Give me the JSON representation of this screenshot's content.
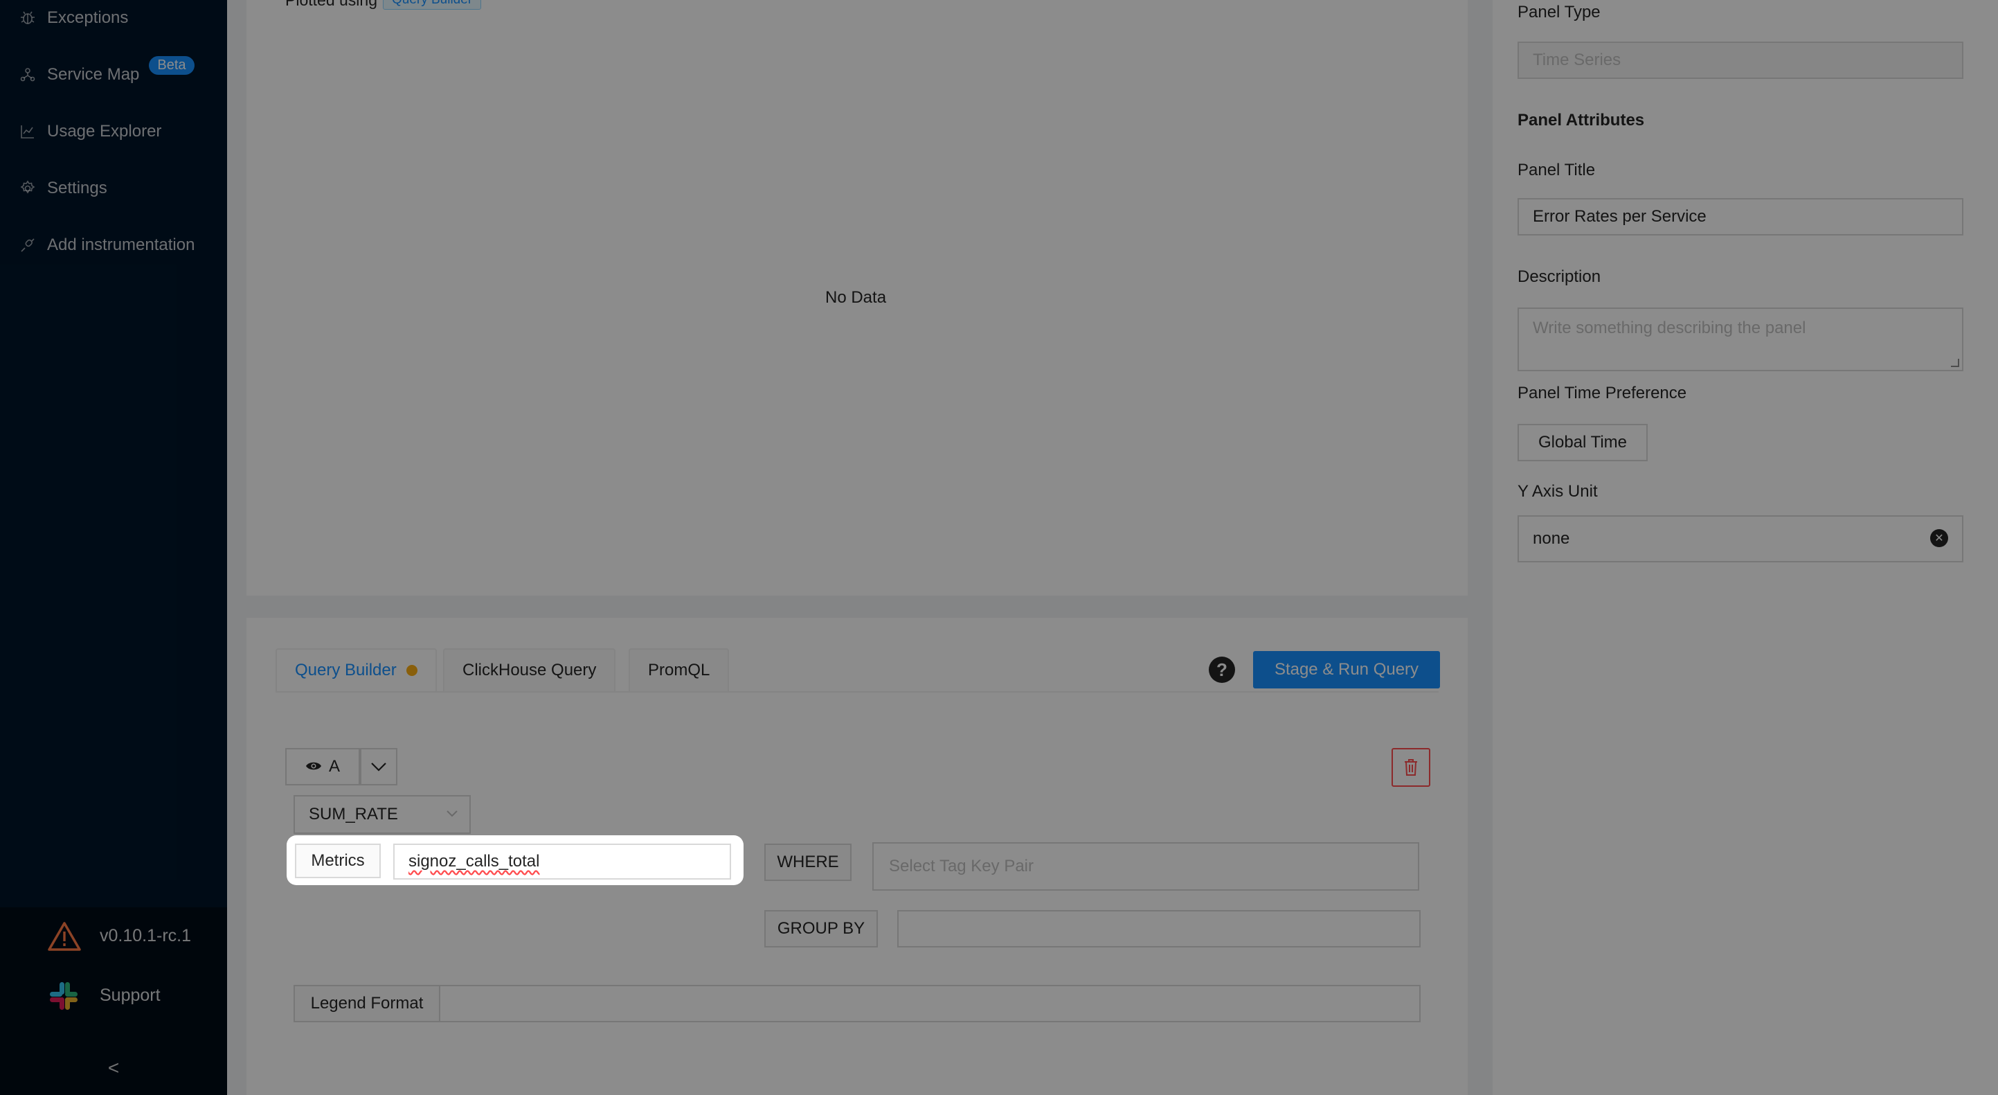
{
  "sidebar": {
    "items": [
      {
        "label": "Exceptions",
        "icon": "bug-icon"
      },
      {
        "label": "Service Map",
        "icon": "deployment-icon",
        "badge": "Beta"
      },
      {
        "label": "Usage Explorer",
        "icon": "line-chart-icon"
      },
      {
        "label": "Settings",
        "icon": "gear-icon"
      },
      {
        "label": "Add instrumentation",
        "icon": "api-icon"
      }
    ],
    "version": "v0.10.1-rc.1",
    "support": "Support",
    "collapse_glyph": "<"
  },
  "plot": {
    "plotted_using_label": "Plotted using",
    "plotted_using_tag": "Query Builder",
    "empty_text": "No Data"
  },
  "query": {
    "tabs": [
      {
        "label": "Query Builder",
        "active": true,
        "has_dot": true
      },
      {
        "label": "ClickHouse Query",
        "active": false
      },
      {
        "label": "PromQL",
        "active": false
      }
    ],
    "help_glyph": "?",
    "stage_button": "Stage & Run Query",
    "query_name": "A",
    "aggregate": "SUM_RATE",
    "metrics_label": "Metrics",
    "metric_value": "signoz_calls_total",
    "where_label": "WHERE",
    "where_placeholder": "Select Tag Key Pair",
    "group_by_label": "GROUP BY",
    "legend_label": "Legend Format"
  },
  "right_panel": {
    "panel_type_label": "Panel Type",
    "panel_type_value": "Time Series",
    "attributes_heading": "Panel Attributes",
    "title_label": "Panel Title",
    "title_value": "Error Rates per Service",
    "description_label": "Description",
    "description_placeholder": "Write something describing the  panel",
    "time_pref_label": "Panel Time Preference",
    "time_pref_value": "Global Time",
    "y_axis_label": "Y Axis Unit",
    "y_axis_value": "none"
  }
}
